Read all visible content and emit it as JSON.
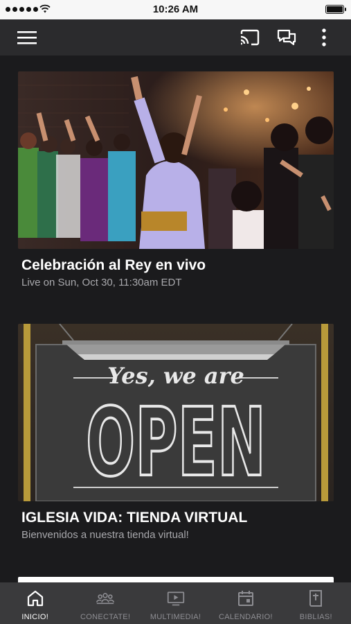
{
  "status_bar": {
    "time": "10:26 AM"
  },
  "app_bar": {
    "icons": [
      "menu-icon",
      "cast-icon",
      "chat-icon",
      "more-vert-icon"
    ]
  },
  "feed": {
    "items": [
      {
        "title": "Celebración al Rey en vivo",
        "subtitle": "Live on Sun, Oct 30, 11:30am EDT"
      },
      {
        "title": "IGLESIA VIDA: TIENDA VIRTUAL",
        "subtitle": "Bienvenidos a nuestra tienda virtual!",
        "image_text": {
          "script": "Yes, we are",
          "big": "OPEN"
        }
      }
    ]
  },
  "tab_bar": {
    "active": "INICIO!",
    "tabs": [
      {
        "label": "INICIO!",
        "icon": "home-icon"
      },
      {
        "label": "CONECTATE!",
        "icon": "group-icon"
      },
      {
        "label": "MULTIMEDIA!",
        "icon": "video-icon"
      },
      {
        "label": "CALENDARIO!",
        "icon": "calendar-icon"
      },
      {
        "label": "BIBLIAS!",
        "icon": "bible-icon"
      }
    ]
  },
  "colors": {
    "background": "#1b1b1d",
    "app_bar": "#2b2b2d",
    "tab_bar": "#3a3a3c",
    "tab_active": "#ffffff",
    "tab_inactive": "#8e8e93"
  }
}
